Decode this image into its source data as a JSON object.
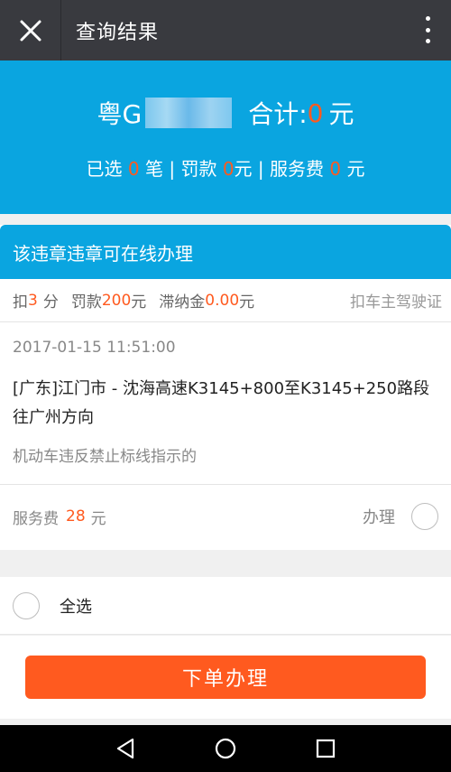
{
  "topbar": {
    "title": "查询结果"
  },
  "summary": {
    "plate_prefix": "粤G",
    "total_label": "合计:",
    "total_value": "0",
    "total_unit": "元",
    "selected_label": "已选",
    "selected_count": "0",
    "selected_unit": "笔",
    "fine_label": "罚款",
    "fine_value": "0",
    "fine_unit": "元",
    "service_label": "服务费",
    "service_value": "0",
    "service_unit": "元"
  },
  "violation": {
    "header": "该违章违章可在线办理",
    "points_prefix": "扣",
    "points": "3",
    "points_unit": "分",
    "fine_prefix": "罚款",
    "fine": "200",
    "fine_unit": "元",
    "late_prefix": "滞纳金",
    "late_fee": "0.00",
    "late_unit": "元",
    "deduct_note": "扣车主驾驶证",
    "time": "2017-01-15 11:51:00",
    "location": "[广东]江门市 - 沈海高速K3145+800至K3145+250路段往广州方向",
    "description": "机动车违反禁止标线指示的",
    "service_prefix": "服务费",
    "service_fee": "28",
    "service_unit": "元",
    "handle_label": "办理"
  },
  "footer": {
    "select_all_label": "全选",
    "submit_label": "下单办理"
  },
  "colors": {
    "accent_blue": "#0aa5e0",
    "accent_orange": "#ff5a1f",
    "topbar": "#393a3f"
  },
  "icons": {
    "close": "close-icon",
    "more": "more-vertical-icon",
    "back": "nav-back-icon",
    "home": "nav-home-icon",
    "recents": "nav-recents-icon"
  }
}
